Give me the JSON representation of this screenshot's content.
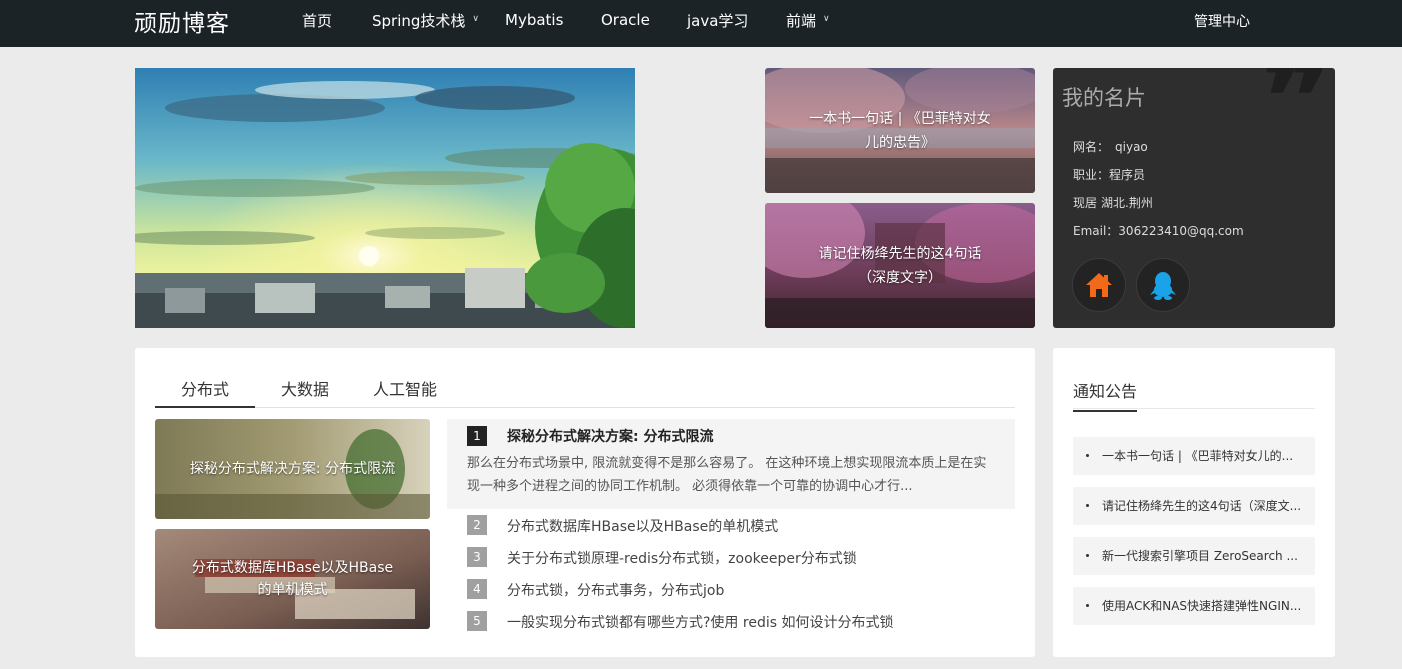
{
  "header": {
    "logo": "顽励博客",
    "nav": [
      {
        "label": "首页",
        "dropdown": false
      },
      {
        "label": "Spring技术栈",
        "dropdown": true
      },
      {
        "label": "Mybatis",
        "dropdown": false
      },
      {
        "label": "Oracle",
        "dropdown": false
      },
      {
        "label": "java学习",
        "dropdown": false
      },
      {
        "label": "前端",
        "dropdown": true
      }
    ],
    "admin": "管理中心"
  },
  "top_cards": [
    {
      "title": "一本书一句话 | 《巴菲特对女儿的忠告》"
    },
    {
      "title": "请记住杨绛先生的这4句话（深度文字）"
    }
  ],
  "profile": {
    "heading": "我的名片",
    "quote_mark": "❞",
    "rows": [
      {
        "label": "网名：",
        "value": "qiyao"
      },
      {
        "label": "职业：",
        "value": "程序员"
      },
      {
        "label": "现居",
        "value": "湖北.荆州"
      },
      {
        "label": "Email：",
        "value": "306223410@qq.com"
      }
    ],
    "icons": [
      "home-icon",
      "qq-icon"
    ]
  },
  "tabs": [
    "分布式",
    "大数据",
    "人工智能"
  ],
  "thumbs": [
    {
      "title": "探秘分布式解决方案: 分布式限流"
    },
    {
      "title": "分布式数据库HBase以及HBase的单机模式"
    }
  ],
  "featured": {
    "num": "1",
    "title": "探秘分布式解决方案: 分布式限流",
    "desc": "那么在分布式场景中, 限流就变得不是那么容易了。 在这种环境上想实现限流本质上是在实现一种多个进程之间的协同工作机制。 必须得依靠一个可靠的协调中心才行..."
  },
  "list": [
    {
      "num": "2",
      "title": "分布式数据库HBase以及HBase的单机模式"
    },
    {
      "num": "3",
      "title": "关于分布式锁原理-redis分布式锁，zookeeper分布式锁"
    },
    {
      "num": "4",
      "title": "分布式锁，分布式事务，分布式job"
    },
    {
      "num": "5",
      "title": "一般实现分布式锁都有哪些方式?使用 redis 如何设计分布式锁"
    }
  ],
  "notice": {
    "heading": "通知公告",
    "items": [
      "一本书一句话 | 《巴菲特对女儿的...",
      "请记住杨绛先生的这4句话（深度文...",
      "新一代搜索引擎项目 ZeroSearch ...",
      "使用ACK和NAS快速搭建弹性NGIN..."
    ]
  },
  "colors": {
    "topbar": "#1c2327",
    "page_bg": "#ebebeb",
    "profile_bg": "#2e2e2e",
    "home_icon": "#f06a1a",
    "qq_icon": "#1aa3e8"
  }
}
